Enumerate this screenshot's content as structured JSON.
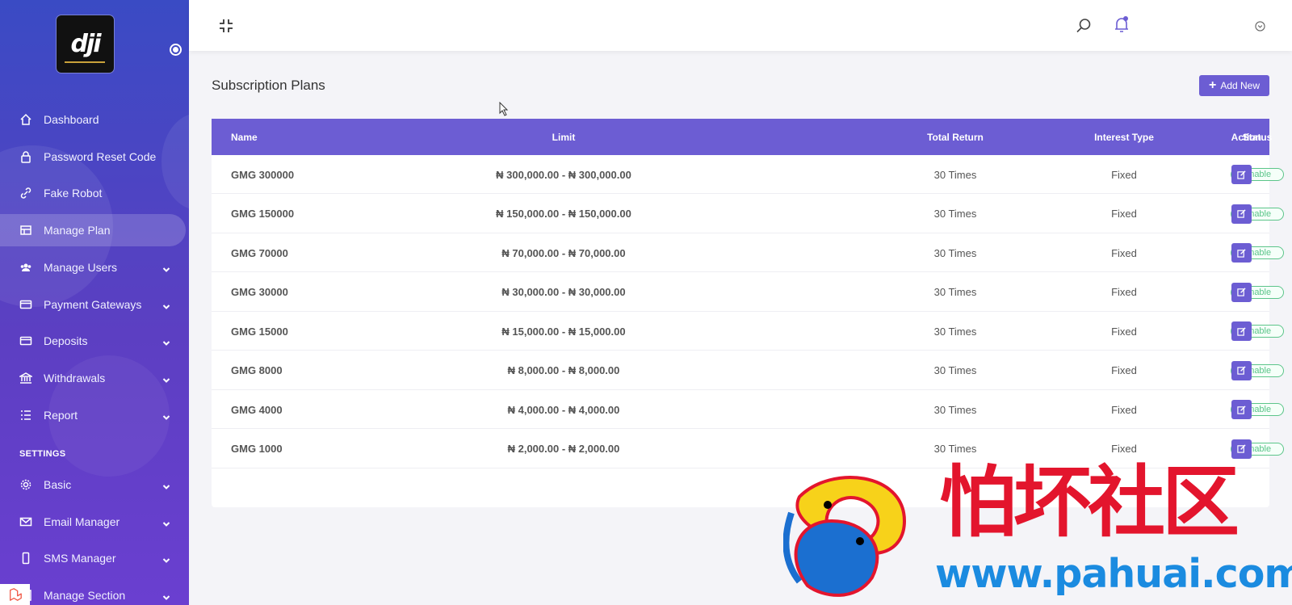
{
  "brand": {
    "logo_text": "dji"
  },
  "sidebar": {
    "items": [
      {
        "label": "Dashboard",
        "icon": "home-icon",
        "has_chevron": false
      },
      {
        "label": "Password Reset Code",
        "icon": "lock-icon",
        "has_chevron": false
      },
      {
        "label": "Fake Robot",
        "icon": "link-icon",
        "has_chevron": false
      },
      {
        "label": "Manage Plan",
        "icon": "plan-icon",
        "has_chevron": false,
        "active": true
      },
      {
        "label": "Manage Users",
        "icon": "users-icon",
        "has_chevron": true
      },
      {
        "label": "Payment Gateways",
        "icon": "credit-card-icon",
        "has_chevron": true
      },
      {
        "label": "Deposits",
        "icon": "credit-card-icon",
        "has_chevron": true
      },
      {
        "label": "Withdrawals",
        "icon": "bank-icon",
        "has_chevron": true
      },
      {
        "label": "Report",
        "icon": "list-icon",
        "has_chevron": true
      }
    ],
    "settings_title": "SETTINGS",
    "settings_items": [
      {
        "label": "Basic",
        "icon": "gear-icon",
        "has_chevron": true
      },
      {
        "label": "Email Manager",
        "icon": "mail-icon",
        "has_chevron": true
      },
      {
        "label": "SMS Manager",
        "icon": "mobile-icon",
        "has_chevron": true
      },
      {
        "label": "Manage Section",
        "icon": "section-icon",
        "has_chevron": true
      }
    ]
  },
  "page": {
    "title": "Subscription Plans",
    "add_button": "Add New"
  },
  "table": {
    "headers": {
      "name": "Name",
      "limit": "Limit",
      "total_return": "Total Return",
      "interest_type": "Interest Type",
      "status": "Status",
      "action": "Action"
    },
    "rows": [
      {
        "name": "GMG 300000",
        "limit": "₦ 300,000.00 - ₦ 300,000.00",
        "total_return": "30 Times",
        "interest_type": "Fixed",
        "status": "Enable"
      },
      {
        "name": "GMG 150000",
        "limit": "₦ 150,000.00 - ₦ 150,000.00",
        "total_return": "30 Times",
        "interest_type": "Fixed",
        "status": "Enable"
      },
      {
        "name": "GMG 70000",
        "limit": "₦ 70,000.00 - ₦ 70,000.00",
        "total_return": "30 Times",
        "interest_type": "Fixed",
        "status": "Enable"
      },
      {
        "name": "GMG 30000",
        "limit": "₦ 30,000.00 - ₦ 30,000.00",
        "total_return": "30 Times",
        "interest_type": "Fixed",
        "status": "Enable"
      },
      {
        "name": "GMG 15000",
        "limit": "₦ 15,000.00 - ₦ 15,000.00",
        "total_return": "30 Times",
        "interest_type": "Fixed",
        "status": "Enable"
      },
      {
        "name": "GMG 8000",
        "limit": "₦ 8,000.00 - ₦ 8,000.00",
        "total_return": "30 Times",
        "interest_type": "Fixed",
        "status": "Enable"
      },
      {
        "name": "GMG 4000",
        "limit": "₦ 4,000.00 - ₦ 4,000.00",
        "total_return": "30 Times",
        "interest_type": "Fixed",
        "status": "Enable"
      },
      {
        "name": "GMG 1000",
        "limit": "₦ 2,000.00 - ₦ 2,000.00",
        "total_return": "30 Times",
        "interest_type": "Fixed",
        "status": "Enable"
      }
    ]
  },
  "watermark": {
    "cn_text": "怕坏社区",
    "url": "www.pahuai.com"
  },
  "colors": {
    "accent": "#6c5dd3",
    "status_enable": "#5cc58a",
    "sidebar_top": "#3a4bc4",
    "sidebar_bottom": "#6a3fd0",
    "watermark_red": "#e3152d",
    "watermark_blue": "#1b8be0"
  }
}
